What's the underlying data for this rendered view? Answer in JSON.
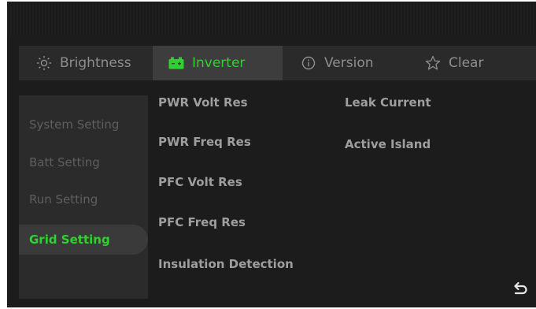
{
  "tabs": [
    {
      "label": "Brightness",
      "icon": "sun-icon"
    },
    {
      "label": "Inverter",
      "icon": "battery-icon"
    },
    {
      "label": "Version",
      "icon": "info-icon"
    },
    {
      "label": "Clear",
      "icon": "star-icon"
    }
  ],
  "sidebar": {
    "items": [
      {
        "label": "System Setting"
      },
      {
        "label": "Batt Setting"
      },
      {
        "label": "Run Setting"
      },
      {
        "label": "Grid Setting"
      }
    ]
  },
  "options": {
    "col1": [
      "PWR Volt Res",
      "PWR Freq Res",
      "PFC Volt Res",
      "PFC Freq Res",
      "Insulation Detection"
    ],
    "col2": [
      "Leak Current",
      "Active Island"
    ]
  },
  "colors": {
    "accent": "#2fd12f",
    "background": "#1c1c1c",
    "tabbar": "#2a2a2a",
    "sidebar": "#2b2b2b"
  },
  "back_icon": "back-arrow-icon"
}
